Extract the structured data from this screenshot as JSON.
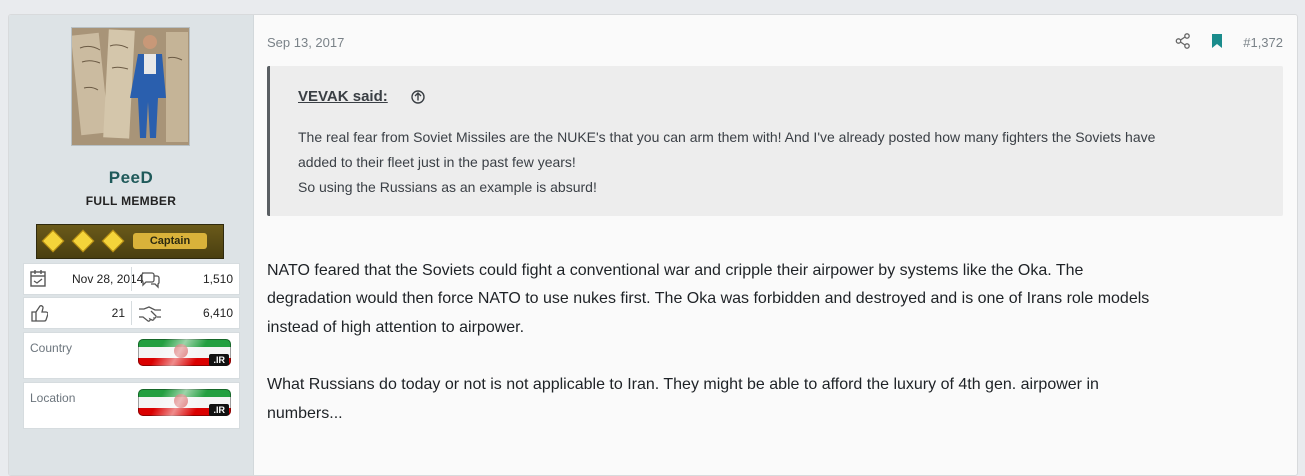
{
  "user": {
    "name": "PeeD",
    "title": "FULL MEMBER",
    "rank": "Captain",
    "joined": "Nov 28, 2014",
    "messages": "1,510",
    "reactions": "21",
    "points": "6,410",
    "country_label": "Country",
    "location_label": "Location",
    "flag_tld": ".IR"
  },
  "post": {
    "date": "Sep 13, 2017",
    "number": "#1,372",
    "quote": {
      "author": "VEVAK said:",
      "lines": [
        "The real fear from Soviet Missiles are the NUKE's that you can arm them with! And I've already posted how many fighters the Soviets have",
        "added to their fleet just in the past few years!",
        "So using the Russians as an example is absurd!"
      ]
    },
    "body_lines": [
      "NATO feared that the Soviets could fight a conventional war and cripple their airpower by systems like the Oka. The",
      "degradation would then force NATO to use nukes first. The Oka was forbidden and destroyed and is one of Irans role models",
      "instead of high attention to airpower.",
      "What Russians do today or not is not applicable to Iran. They might be able to afford the luxury of 4th gen. airpower in",
      "numbers..."
    ]
  },
  "icons": {
    "share": "share-icon",
    "bookmark": "bookmark-icon",
    "quote_link": "arrow-up-circle-icon",
    "joined": "calendar-icon",
    "messages": "comments-icon",
    "reactions": "thumbs-up-icon",
    "points": "handshake-icon"
  },
  "colors": {
    "accent": "#1a8c8c",
    "username": "#1f5a5a",
    "rank_bg": "#4a3f10",
    "rank_gold": "#f4d43a"
  }
}
